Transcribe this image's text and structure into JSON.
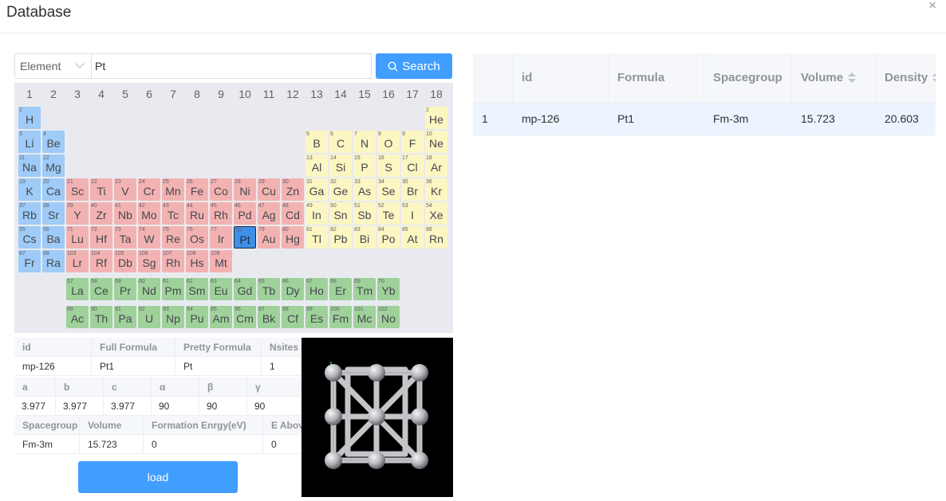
{
  "window": {
    "title": "Database",
    "close_icon": "×"
  },
  "search": {
    "select_value": "Element",
    "query": "Pt",
    "button_label": "Search"
  },
  "periodic_table": {
    "groups": [
      "1",
      "2",
      "3",
      "4",
      "5",
      "6",
      "7",
      "8",
      "9",
      "10",
      "11",
      "12",
      "13",
      "14",
      "15",
      "16",
      "17",
      "18"
    ],
    "selected": "Pt",
    "elements": [
      {
        "n": "1",
        "s": "H",
        "r": 0,
        "c": 0,
        "t": "alk"
      },
      {
        "n": "2",
        "s": "He",
        "r": 0,
        "c": 17,
        "t": "nm"
      },
      {
        "n": "3",
        "s": "Li",
        "r": 1,
        "c": 0,
        "t": "alk"
      },
      {
        "n": "4",
        "s": "Be",
        "r": 1,
        "c": 1,
        "t": "alk"
      },
      {
        "n": "5",
        "s": "B",
        "r": 1,
        "c": 12,
        "t": "nm"
      },
      {
        "n": "6",
        "s": "C",
        "r": 1,
        "c": 13,
        "t": "nm"
      },
      {
        "n": "7",
        "s": "N",
        "r": 1,
        "c": 14,
        "t": "nm"
      },
      {
        "n": "8",
        "s": "O",
        "r": 1,
        "c": 15,
        "t": "nm"
      },
      {
        "n": "9",
        "s": "F",
        "r": 1,
        "c": 16,
        "t": "nm"
      },
      {
        "n": "10",
        "s": "Ne",
        "r": 1,
        "c": 17,
        "t": "nm"
      },
      {
        "n": "11",
        "s": "Na",
        "r": 2,
        "c": 0,
        "t": "alk"
      },
      {
        "n": "12",
        "s": "Mg",
        "r": 2,
        "c": 1,
        "t": "alk"
      },
      {
        "n": "13",
        "s": "Al",
        "r": 2,
        "c": 12,
        "t": "nm"
      },
      {
        "n": "14",
        "s": "Si",
        "r": 2,
        "c": 13,
        "t": "nm"
      },
      {
        "n": "15",
        "s": "P",
        "r": 2,
        "c": 14,
        "t": "nm"
      },
      {
        "n": "16",
        "s": "S",
        "r": 2,
        "c": 15,
        "t": "nm"
      },
      {
        "n": "17",
        "s": "Cl",
        "r": 2,
        "c": 16,
        "t": "nm"
      },
      {
        "n": "18",
        "s": "Ar",
        "r": 2,
        "c": 17,
        "t": "nm"
      },
      {
        "n": "19",
        "s": "K",
        "r": 3,
        "c": 0,
        "t": "alk"
      },
      {
        "n": "20",
        "s": "Ca",
        "r": 3,
        "c": 1,
        "t": "alk"
      },
      {
        "n": "21",
        "s": "Sc",
        "r": 3,
        "c": 2,
        "t": "tr"
      },
      {
        "n": "22",
        "s": "Ti",
        "r": 3,
        "c": 3,
        "t": "tr"
      },
      {
        "n": "23",
        "s": "V",
        "r": 3,
        "c": 4,
        "t": "tr"
      },
      {
        "n": "24",
        "s": "Cr",
        "r": 3,
        "c": 5,
        "t": "tr"
      },
      {
        "n": "25",
        "s": "Mn",
        "r": 3,
        "c": 6,
        "t": "tr"
      },
      {
        "n": "26",
        "s": "Fe",
        "r": 3,
        "c": 7,
        "t": "tr"
      },
      {
        "n": "27",
        "s": "Co",
        "r": 3,
        "c": 8,
        "t": "tr"
      },
      {
        "n": "28",
        "s": "Ni",
        "r": 3,
        "c": 9,
        "t": "tr"
      },
      {
        "n": "29",
        "s": "Cu",
        "r": 3,
        "c": 10,
        "t": "tr"
      },
      {
        "n": "30",
        "s": "Zn",
        "r": 3,
        "c": 11,
        "t": "tr"
      },
      {
        "n": "31",
        "s": "Ga",
        "r": 3,
        "c": 12,
        "t": "nm"
      },
      {
        "n": "32",
        "s": "Ge",
        "r": 3,
        "c": 13,
        "t": "nm"
      },
      {
        "n": "33",
        "s": "As",
        "r": 3,
        "c": 14,
        "t": "nm"
      },
      {
        "n": "34",
        "s": "Se",
        "r": 3,
        "c": 15,
        "t": "nm"
      },
      {
        "n": "35",
        "s": "Br",
        "r": 3,
        "c": 16,
        "t": "nm"
      },
      {
        "n": "36",
        "s": "Kr",
        "r": 3,
        "c": 17,
        "t": "nm"
      },
      {
        "n": "37",
        "s": "Rb",
        "r": 4,
        "c": 0,
        "t": "alk"
      },
      {
        "n": "38",
        "s": "Sr",
        "r": 4,
        "c": 1,
        "t": "alk"
      },
      {
        "n": "39",
        "s": "Y",
        "r": 4,
        "c": 2,
        "t": "tr"
      },
      {
        "n": "40",
        "s": "Zr",
        "r": 4,
        "c": 3,
        "t": "tr"
      },
      {
        "n": "41",
        "s": "Nb",
        "r": 4,
        "c": 4,
        "t": "tr"
      },
      {
        "n": "42",
        "s": "Mo",
        "r": 4,
        "c": 5,
        "t": "tr"
      },
      {
        "n": "43",
        "s": "Tc",
        "r": 4,
        "c": 6,
        "t": "tr"
      },
      {
        "n": "44",
        "s": "Ru",
        "r": 4,
        "c": 7,
        "t": "tr"
      },
      {
        "n": "45",
        "s": "Rh",
        "r": 4,
        "c": 8,
        "t": "tr"
      },
      {
        "n": "46",
        "s": "Pd",
        "r": 4,
        "c": 9,
        "t": "tr"
      },
      {
        "n": "47",
        "s": "Ag",
        "r": 4,
        "c": 10,
        "t": "tr"
      },
      {
        "n": "48",
        "s": "Cd",
        "r": 4,
        "c": 11,
        "t": "tr"
      },
      {
        "n": "49",
        "s": "In",
        "r": 4,
        "c": 12,
        "t": "nm"
      },
      {
        "n": "50",
        "s": "Sn",
        "r": 4,
        "c": 13,
        "t": "nm"
      },
      {
        "n": "51",
        "s": "Sb",
        "r": 4,
        "c": 14,
        "t": "nm"
      },
      {
        "n": "52",
        "s": "Te",
        "r": 4,
        "c": 15,
        "t": "nm"
      },
      {
        "n": "53",
        "s": "I",
        "r": 4,
        "c": 16,
        "t": "nm"
      },
      {
        "n": "54",
        "s": "Xe",
        "r": 4,
        "c": 17,
        "t": "nm"
      },
      {
        "n": "55",
        "s": "Cs",
        "r": 5,
        "c": 0,
        "t": "alk"
      },
      {
        "n": "56",
        "s": "Ba",
        "r": 5,
        "c": 1,
        "t": "alk"
      },
      {
        "n": "71",
        "s": "Lu",
        "r": 5,
        "c": 2,
        "t": "tr"
      },
      {
        "n": "72",
        "s": "Hf",
        "r": 5,
        "c": 3,
        "t": "tr"
      },
      {
        "n": "73",
        "s": "Ta",
        "r": 5,
        "c": 4,
        "t": "tr"
      },
      {
        "n": "74",
        "s": "W",
        "r": 5,
        "c": 5,
        "t": "tr"
      },
      {
        "n": "75",
        "s": "Re",
        "r": 5,
        "c": 6,
        "t": "tr"
      },
      {
        "n": "76",
        "s": "Os",
        "r": 5,
        "c": 7,
        "t": "tr"
      },
      {
        "n": "77",
        "s": "Ir",
        "r": 5,
        "c": 8,
        "t": "tr"
      },
      {
        "n": "78",
        "s": "Pt",
        "r": 5,
        "c": 9,
        "t": "sel"
      },
      {
        "n": "79",
        "s": "Au",
        "r": 5,
        "c": 10,
        "t": "tr"
      },
      {
        "n": "80",
        "s": "Hg",
        "r": 5,
        "c": 11,
        "t": "tr"
      },
      {
        "n": "81",
        "s": "Tl",
        "r": 5,
        "c": 12,
        "t": "nm"
      },
      {
        "n": "82",
        "s": "Pb",
        "r": 5,
        "c": 13,
        "t": "nm"
      },
      {
        "n": "83",
        "s": "Bi",
        "r": 5,
        "c": 14,
        "t": "nm"
      },
      {
        "n": "84",
        "s": "Po",
        "r": 5,
        "c": 15,
        "t": "nm"
      },
      {
        "n": "85",
        "s": "At",
        "r": 5,
        "c": 16,
        "t": "nm"
      },
      {
        "n": "86",
        "s": "Rn",
        "r": 5,
        "c": 17,
        "t": "nm"
      },
      {
        "n": "87",
        "s": "Fr",
        "r": 6,
        "c": 0,
        "t": "alk"
      },
      {
        "n": "88",
        "s": "Ra",
        "r": 6,
        "c": 1,
        "t": "alk"
      },
      {
        "n": "103",
        "s": "Lr",
        "r": 6,
        "c": 2,
        "t": "tr"
      },
      {
        "n": "104",
        "s": "Rf",
        "r": 6,
        "c": 3,
        "t": "tr"
      },
      {
        "n": "105",
        "s": "Db",
        "r": 6,
        "c": 4,
        "t": "tr"
      },
      {
        "n": "106",
        "s": "Sg",
        "r": 6,
        "c": 5,
        "t": "tr"
      },
      {
        "n": "107",
        "s": "Rh",
        "r": 6,
        "c": 6,
        "t": "tr"
      },
      {
        "n": "108",
        "s": "Hs",
        "r": 6,
        "c": 7,
        "t": "tr"
      },
      {
        "n": "109",
        "s": "Mt",
        "r": 6,
        "c": 8,
        "t": "tr"
      },
      {
        "n": "57",
        "s": "La",
        "r": 7,
        "c": 2,
        "t": "lan"
      },
      {
        "n": "58",
        "s": "Ce",
        "r": 7,
        "c": 3,
        "t": "lan"
      },
      {
        "n": "59",
        "s": "Pr",
        "r": 7,
        "c": 4,
        "t": "lan"
      },
      {
        "n": "60",
        "s": "Nd",
        "r": 7,
        "c": 5,
        "t": "lan"
      },
      {
        "n": "61",
        "s": "Pm",
        "r": 7,
        "c": 6,
        "t": "lan"
      },
      {
        "n": "62",
        "s": "Sm",
        "r": 7,
        "c": 7,
        "t": "lan"
      },
      {
        "n": "63",
        "s": "Eu",
        "r": 7,
        "c": 8,
        "t": "lan"
      },
      {
        "n": "64",
        "s": "Gd",
        "r": 7,
        "c": 9,
        "t": "lan"
      },
      {
        "n": "65",
        "s": "Tb",
        "r": 7,
        "c": 10,
        "t": "lan"
      },
      {
        "n": "66",
        "s": "Dy",
        "r": 7,
        "c": 11,
        "t": "lan"
      },
      {
        "n": "67",
        "s": "Ho",
        "r": 7,
        "c": 12,
        "t": "lan"
      },
      {
        "n": "68",
        "s": "Er",
        "r": 7,
        "c": 13,
        "t": "lan"
      },
      {
        "n": "69",
        "s": "Tm",
        "r": 7,
        "c": 14,
        "t": "lan"
      },
      {
        "n": "70",
        "s": "Yb",
        "r": 7,
        "c": 15,
        "t": "lan"
      },
      {
        "n": "89",
        "s": "Ac",
        "r": 8,
        "c": 2,
        "t": "lan"
      },
      {
        "n": "90",
        "s": "Th",
        "r": 8,
        "c": 3,
        "t": "lan"
      },
      {
        "n": "91",
        "s": "Pa",
        "r": 8,
        "c": 4,
        "t": "lan"
      },
      {
        "n": "92",
        "s": "U",
        "r": 8,
        "c": 5,
        "t": "lan"
      },
      {
        "n": "93",
        "s": "Np",
        "r": 8,
        "c": 6,
        "t": "lan"
      },
      {
        "n": "94",
        "s": "Pu",
        "r": 8,
        "c": 7,
        "t": "lan"
      },
      {
        "n": "95",
        "s": "Am",
        "r": 8,
        "c": 8,
        "t": "lan"
      },
      {
        "n": "96",
        "s": "Cm",
        "r": 8,
        "c": 9,
        "t": "lan"
      },
      {
        "n": "97",
        "s": "Bk",
        "r": 8,
        "c": 10,
        "t": "lan"
      },
      {
        "n": "98",
        "s": "Cf",
        "r": 8,
        "c": 11,
        "t": "lan"
      },
      {
        "n": "99",
        "s": "Es",
        "r": 8,
        "c": 12,
        "t": "lan"
      },
      {
        "n": "100",
        "s": "Fm",
        "r": 8,
        "c": 13,
        "t": "lan"
      },
      {
        "n": "101",
        "s": "Mc",
        "r": 8,
        "c": 14,
        "t": "lan"
      },
      {
        "n": "102",
        "s": "No",
        "r": 8,
        "c": 15,
        "t": "lan"
      }
    ]
  },
  "detail": {
    "row1_headers": [
      "id",
      "Full Formula",
      "Pretty Formula",
      "Nsites"
    ],
    "row1_values": [
      "mp-126",
      "Pt1",
      "Pt",
      "1"
    ],
    "row2_headers": [
      "a",
      "b",
      "c",
      "α",
      "β",
      "γ"
    ],
    "row2_values": [
      "3.977",
      "3.977",
      "3.977",
      "90",
      "90",
      "90"
    ],
    "row3_headers": [
      "Spacegroup",
      "Volume",
      "Formation Enrgy(eV)",
      "E Above Hull"
    ],
    "row3_values": [
      "Fm-3m",
      "15.723",
      "0",
      "0"
    ]
  },
  "load_label": "load",
  "results": {
    "columns": [
      "",
      "id",
      "Formula",
      "Spacegroup",
      "Volume",
      "Density"
    ],
    "rows": [
      [
        "1",
        "mp-126",
        "Pt1",
        "Fm-3m",
        "15.723",
        "20.603"
      ]
    ]
  }
}
